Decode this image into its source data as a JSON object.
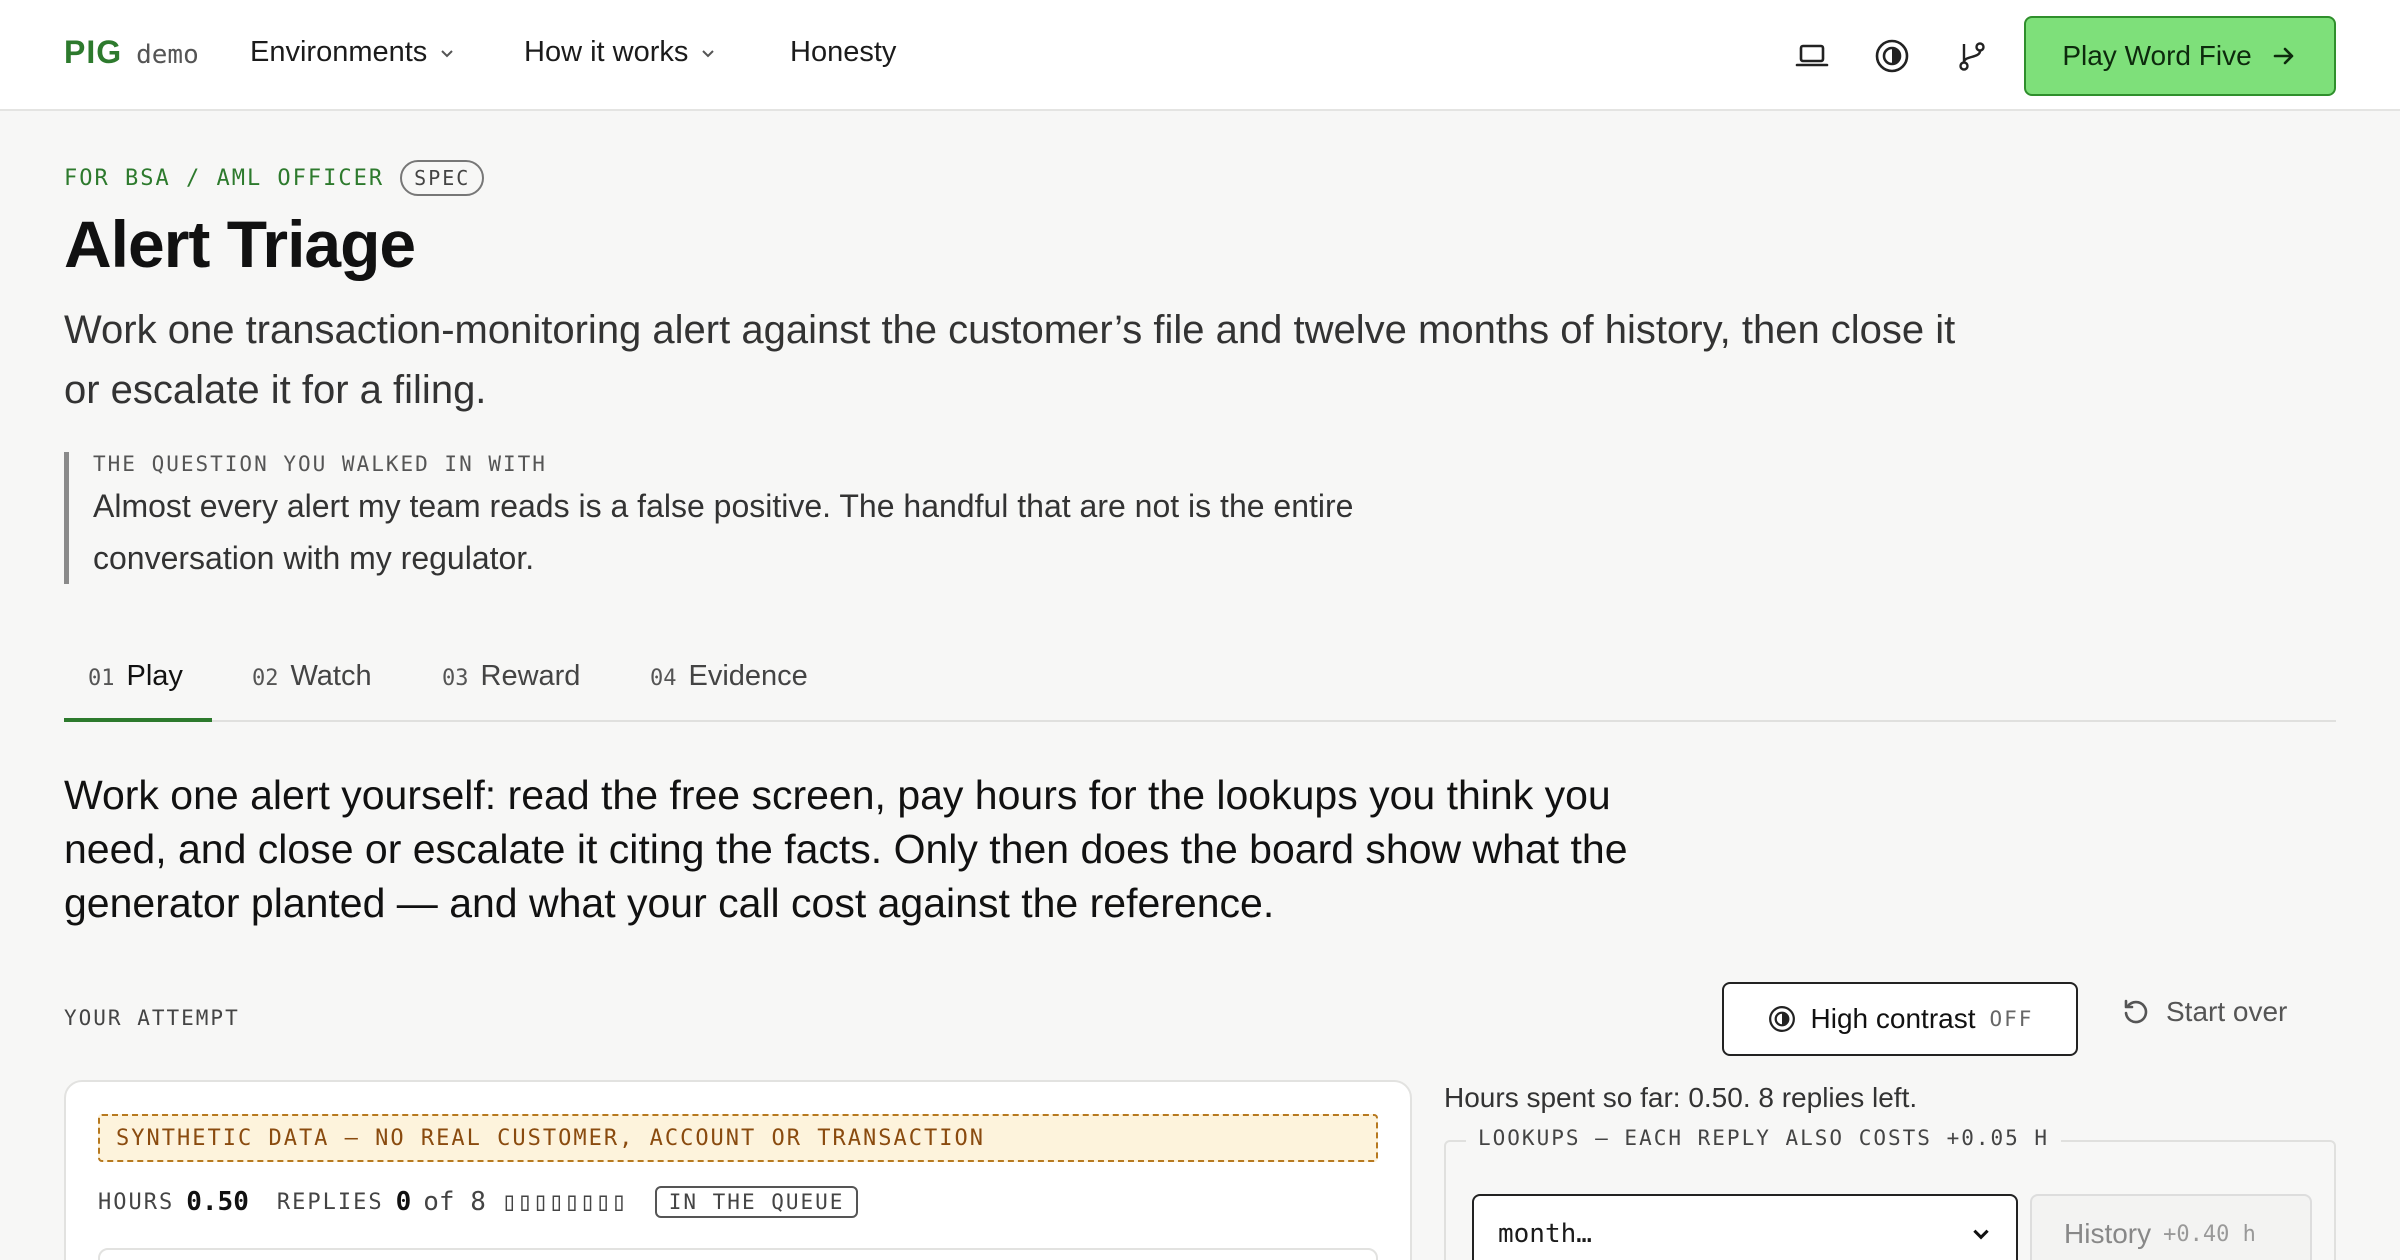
{
  "brand": {
    "name": "PIG",
    "tag": "demo"
  },
  "nav": {
    "environments": "Environments",
    "how_it_works": "How it works",
    "honesty": "Honesty"
  },
  "header_icons": [
    "laptop-icon",
    "contrast-icon",
    "git-branch-icon"
  ],
  "cta": {
    "label": "Play Word Five"
  },
  "page": {
    "eyebrow": "FOR BSA / AML OFFICER",
    "badge": "SPEC",
    "title": "Alert Triage",
    "subtitle": "Work one transaction-monitoring alert against the customer’s file and twelve months of history, then close it or escalate it for a filing.",
    "quote_label": "THE QUESTION YOU WALKED IN WITH",
    "quote_text": "Almost every alert my team reads is a false positive. The handful that are not is the entire conversation with my regulator."
  },
  "tabs": [
    {
      "num": "01",
      "label": "Play",
      "active": true
    },
    {
      "num": "02",
      "label": "Watch",
      "active": false
    },
    {
      "num": "03",
      "label": "Reward",
      "active": false
    },
    {
      "num": "04",
      "label": "Evidence",
      "active": false
    }
  ],
  "lead": "Work one alert yourself: read the free screen, pay hours for the lookups you think you need, and close or escalate it citing the facts. Only then does the board show what the generator planted — and what your call cost against the reference.",
  "attempt": {
    "label": "YOUR ATTEMPT",
    "high_contrast_label": "High contrast",
    "high_contrast_state": "OFF",
    "start_over": "Start over",
    "synthetic_banner": "SYNTHETIC DATA — NO REAL CUSTOMER, ACCOUNT OR TRANSACTION",
    "hours_key": "HOURS",
    "hours_value": "0.50",
    "replies_key": "REPLIES",
    "replies_value": "0",
    "replies_of": "of 8 ▯▯▯▯▯▯▯▯",
    "status_badge": "IN THE QUEUE",
    "hours_note": "Hours spent so far: 0.50. 8 replies left.",
    "lookups_legend": "LOOKUPS — EACH REPLY ALSO COSTS +0.05 H",
    "lookup_selected": "month…",
    "history_label": "History",
    "history_cost": "+0.40 h"
  },
  "colors": {
    "accent": "#2d7a2d",
    "cta_bg": "#7ee07a",
    "banner_bg": "#fdf3dc",
    "banner_border": "#b7791f"
  }
}
